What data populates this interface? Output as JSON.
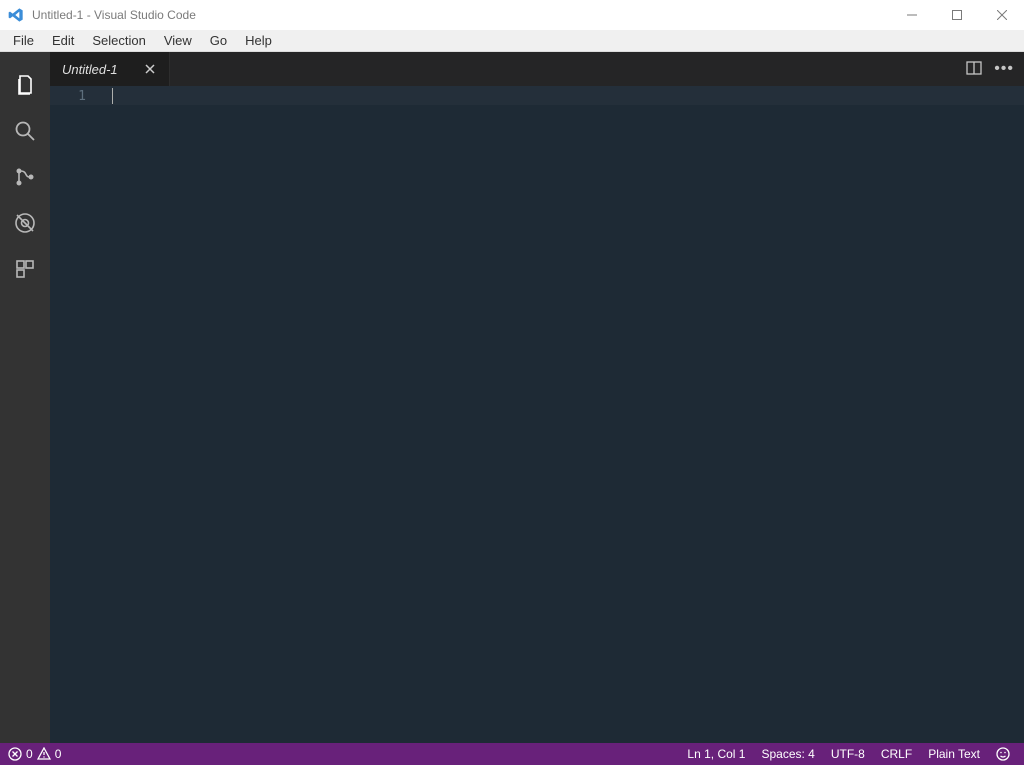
{
  "window": {
    "title": "Untitled-1 - Visual Studio Code"
  },
  "menu": {
    "items": [
      "File",
      "Edit",
      "Selection",
      "View",
      "Go",
      "Help"
    ]
  },
  "tab": {
    "label": "Untitled-1"
  },
  "editor": {
    "line_number": "1"
  },
  "status": {
    "errors": "0",
    "warnings": "0",
    "cursor": "Ln 1, Col 1",
    "indent": "Spaces: 4",
    "encoding": "UTF-8",
    "eol": "CRLF",
    "language": "Plain Text"
  }
}
